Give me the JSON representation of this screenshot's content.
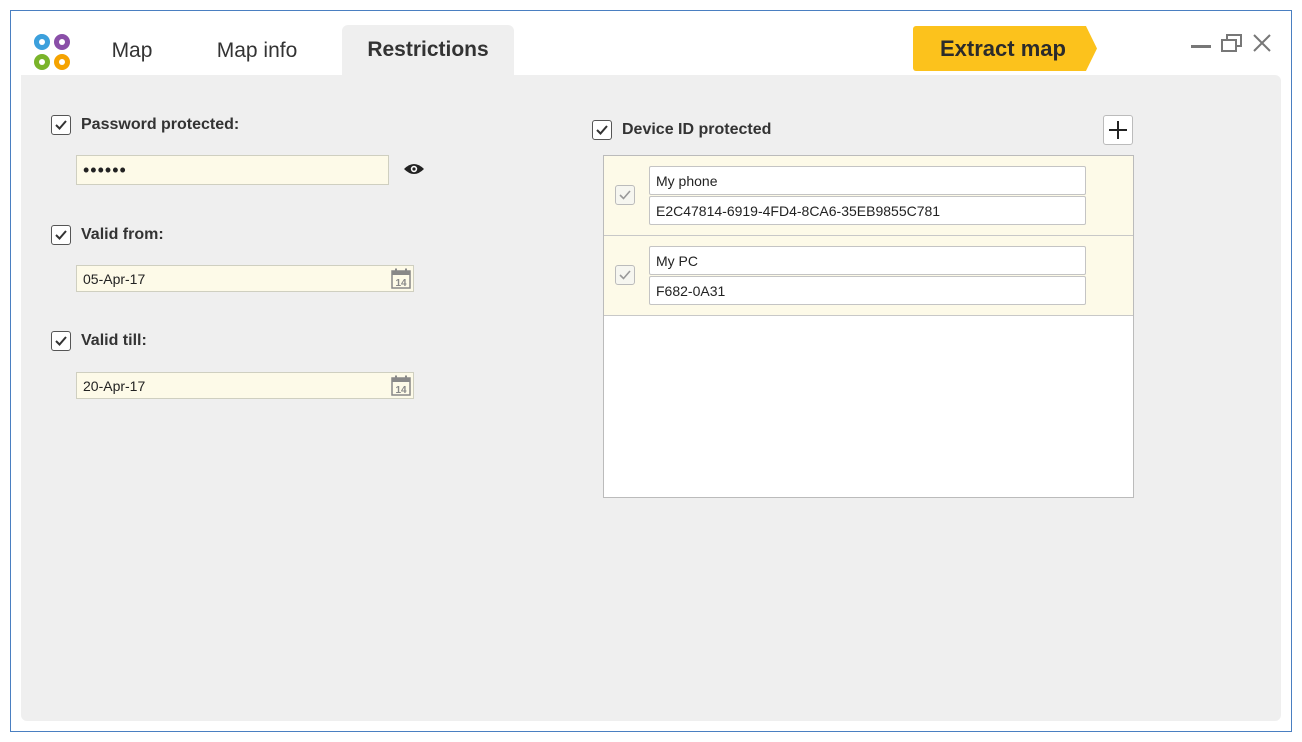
{
  "tabs": [
    {
      "label": "Map",
      "active": false
    },
    {
      "label": "Map info",
      "active": false
    },
    {
      "label": "Restrictions",
      "active": true
    }
  ],
  "extract_button": {
    "label": "Extract map",
    "color": "#fcc21c"
  },
  "logo_colors": [
    "#3ca0dc",
    "#8a4fa8",
    "#7ab42a",
    "#f5a300"
  ],
  "restrictions": {
    "password": {
      "label": "Password protected:",
      "checked": true,
      "value": "••••••",
      "reveal_icon": "eye-icon"
    },
    "valid_from": {
      "label": "Valid from:",
      "checked": true,
      "value": "05-Apr-17",
      "calendar_icon": "calendar-icon"
    },
    "valid_till": {
      "label": "Valid till:",
      "checked": true,
      "value": "20-Apr-17",
      "calendar_icon": "calendar-icon"
    }
  },
  "device": {
    "label": "Device ID protected",
    "checked": true,
    "add_icon": "plus-icon",
    "devices": [
      {
        "name": "My phone",
        "id": "E2C47814-6919-4FD4-8CA6-35EB9855C781",
        "checked": true
      },
      {
        "name": "My PC",
        "id": "F682-0A31",
        "checked": true
      }
    ]
  },
  "window_controls": [
    "minimize-icon",
    "restore-icon",
    "close-icon"
  ],
  "colors": {
    "accent": "#fcc21c",
    "field_bg": "#fdfae8",
    "panel_bg": "#efefef",
    "border": "#4a7fc1"
  }
}
